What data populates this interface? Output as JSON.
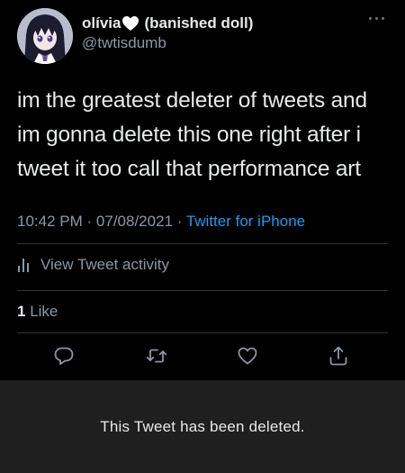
{
  "tweet": {
    "display_name": "olívia",
    "name_suffix": "(banished doll)",
    "name_emoji": "white-heart-icon",
    "handle": "@twtisdumb",
    "text": "im the greatest deleter of tweets and im gonna delete this one right after i tweet it too call that performance art",
    "time": "10:42 PM",
    "separator": "·",
    "date": "07/08/2021",
    "source": "Twitter for iPhone",
    "activity_label": "View Tweet activity",
    "like_count": "1",
    "like_label": "Like"
  },
  "actions": [
    {
      "name": "reply",
      "icon": "reply-icon"
    },
    {
      "name": "retweet",
      "icon": "retweet-icon"
    },
    {
      "name": "like",
      "icon": "heart-icon"
    },
    {
      "name": "share",
      "icon": "share-icon"
    }
  ],
  "banner": {
    "message": "This Tweet has been deleted."
  },
  "colors": {
    "background": "#000000",
    "text": "#e7e9ea",
    "secondary_text": "#8b98a5",
    "link": "#1d9bf0",
    "divider": "#2f3336",
    "banner_background": "#1f1f1f"
  }
}
